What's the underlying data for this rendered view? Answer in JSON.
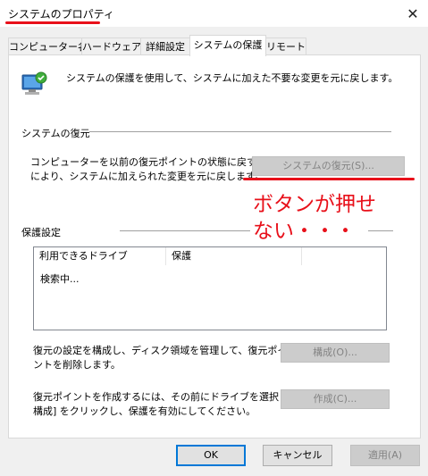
{
  "window": {
    "title": "システムのプロパティ",
    "close_glyph": "✕"
  },
  "tabs": [
    {
      "label": "コンピューター名"
    },
    {
      "label": "ハードウェア"
    },
    {
      "label": "詳細設定"
    },
    {
      "label": "システムの保護"
    },
    {
      "label": "リモート"
    }
  ],
  "intro_text": "システムの保護を使用して、システムに加えた不要な変更を元に戻します。",
  "restore": {
    "heading": "システムの復元",
    "desc_line1": "コンピューターを以前の復元ポイントの状態に戻すこと",
    "desc_line2": "により、システムに加えられた変更を元に戻します。",
    "button_label": "システムの復元(S)..."
  },
  "annotation": {
    "line1": "ボタンが押せ",
    "line2": "ない・・・",
    "color": "#e8101a"
  },
  "protection": {
    "heading": "保護設定",
    "columns": [
      "利用できるドライブ",
      "保護"
    ],
    "rows": [
      "検索中..."
    ],
    "configure_text_line1": "復元の設定を構成し、ディスク領域を管理して、復元ポイ",
    "configure_text_line2": "ントを削除します。",
    "configure_button": "構成(O)...",
    "create_text_line1": "復元ポイントを作成するには、その前にドライブを選択して [",
    "create_text_line2": "構成] をクリックし、保護を有効にしてください。",
    "create_button": "作成(C)..."
  },
  "footer": {
    "ok": "OK",
    "cancel": "キャンセル",
    "apply": "適用(A)"
  }
}
